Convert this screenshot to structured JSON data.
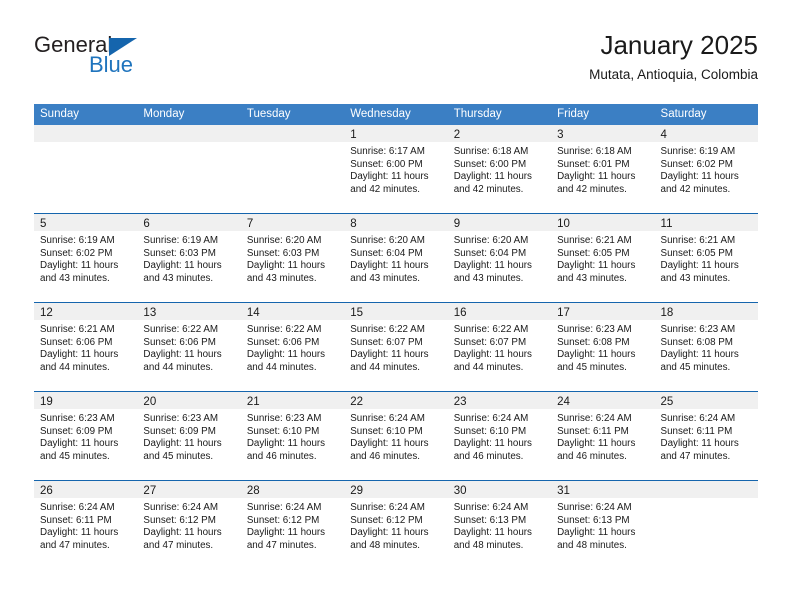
{
  "brand": {
    "name_part1": "General",
    "name_part2": "Blue",
    "accent_color": "#1565ad"
  },
  "header": {
    "title": "January 2025",
    "location": "Mutata, Antioquia, Colombia"
  },
  "theme": {
    "header_row_bg": "#3b7fc4",
    "row_separator": "#1565ad",
    "daynum_band_bg": "#f0f0f0",
    "text": "#1a1a1a"
  },
  "weekday_headers": [
    "Sunday",
    "Monday",
    "Tuesday",
    "Wednesday",
    "Thursday",
    "Friday",
    "Saturday"
  ],
  "weeks": [
    [
      {
        "day": "",
        "sunrise": "",
        "sunset": "",
        "daylight_line1": "",
        "daylight_line2": ""
      },
      {
        "day": "",
        "sunrise": "",
        "sunset": "",
        "daylight_line1": "",
        "daylight_line2": ""
      },
      {
        "day": "",
        "sunrise": "",
        "sunset": "",
        "daylight_line1": "",
        "daylight_line2": ""
      },
      {
        "day": "1",
        "sunrise": "Sunrise: 6:17 AM",
        "sunset": "Sunset: 6:00 PM",
        "daylight_line1": "Daylight: 11 hours",
        "daylight_line2": "and 42 minutes."
      },
      {
        "day": "2",
        "sunrise": "Sunrise: 6:18 AM",
        "sunset": "Sunset: 6:00 PM",
        "daylight_line1": "Daylight: 11 hours",
        "daylight_line2": "and 42 minutes."
      },
      {
        "day": "3",
        "sunrise": "Sunrise: 6:18 AM",
        "sunset": "Sunset: 6:01 PM",
        "daylight_line1": "Daylight: 11 hours",
        "daylight_line2": "and 42 minutes."
      },
      {
        "day": "4",
        "sunrise": "Sunrise: 6:19 AM",
        "sunset": "Sunset: 6:02 PM",
        "daylight_line1": "Daylight: 11 hours",
        "daylight_line2": "and 42 minutes."
      }
    ],
    [
      {
        "day": "5",
        "sunrise": "Sunrise: 6:19 AM",
        "sunset": "Sunset: 6:02 PM",
        "daylight_line1": "Daylight: 11 hours",
        "daylight_line2": "and 43 minutes."
      },
      {
        "day": "6",
        "sunrise": "Sunrise: 6:19 AM",
        "sunset": "Sunset: 6:03 PM",
        "daylight_line1": "Daylight: 11 hours",
        "daylight_line2": "and 43 minutes."
      },
      {
        "day": "7",
        "sunrise": "Sunrise: 6:20 AM",
        "sunset": "Sunset: 6:03 PM",
        "daylight_line1": "Daylight: 11 hours",
        "daylight_line2": "and 43 minutes."
      },
      {
        "day": "8",
        "sunrise": "Sunrise: 6:20 AM",
        "sunset": "Sunset: 6:04 PM",
        "daylight_line1": "Daylight: 11 hours",
        "daylight_line2": "and 43 minutes."
      },
      {
        "day": "9",
        "sunrise": "Sunrise: 6:20 AM",
        "sunset": "Sunset: 6:04 PM",
        "daylight_line1": "Daylight: 11 hours",
        "daylight_line2": "and 43 minutes."
      },
      {
        "day": "10",
        "sunrise": "Sunrise: 6:21 AM",
        "sunset": "Sunset: 6:05 PM",
        "daylight_line1": "Daylight: 11 hours",
        "daylight_line2": "and 43 minutes."
      },
      {
        "day": "11",
        "sunrise": "Sunrise: 6:21 AM",
        "sunset": "Sunset: 6:05 PM",
        "daylight_line1": "Daylight: 11 hours",
        "daylight_line2": "and 43 minutes."
      }
    ],
    [
      {
        "day": "12",
        "sunrise": "Sunrise: 6:21 AM",
        "sunset": "Sunset: 6:06 PM",
        "daylight_line1": "Daylight: 11 hours",
        "daylight_line2": "and 44 minutes."
      },
      {
        "day": "13",
        "sunrise": "Sunrise: 6:22 AM",
        "sunset": "Sunset: 6:06 PM",
        "daylight_line1": "Daylight: 11 hours",
        "daylight_line2": "and 44 minutes."
      },
      {
        "day": "14",
        "sunrise": "Sunrise: 6:22 AM",
        "sunset": "Sunset: 6:06 PM",
        "daylight_line1": "Daylight: 11 hours",
        "daylight_line2": "and 44 minutes."
      },
      {
        "day": "15",
        "sunrise": "Sunrise: 6:22 AM",
        "sunset": "Sunset: 6:07 PM",
        "daylight_line1": "Daylight: 11 hours",
        "daylight_line2": "and 44 minutes."
      },
      {
        "day": "16",
        "sunrise": "Sunrise: 6:22 AM",
        "sunset": "Sunset: 6:07 PM",
        "daylight_line1": "Daylight: 11 hours",
        "daylight_line2": "and 44 minutes."
      },
      {
        "day": "17",
        "sunrise": "Sunrise: 6:23 AM",
        "sunset": "Sunset: 6:08 PM",
        "daylight_line1": "Daylight: 11 hours",
        "daylight_line2": "and 45 minutes."
      },
      {
        "day": "18",
        "sunrise": "Sunrise: 6:23 AM",
        "sunset": "Sunset: 6:08 PM",
        "daylight_line1": "Daylight: 11 hours",
        "daylight_line2": "and 45 minutes."
      }
    ],
    [
      {
        "day": "19",
        "sunrise": "Sunrise: 6:23 AM",
        "sunset": "Sunset: 6:09 PM",
        "daylight_line1": "Daylight: 11 hours",
        "daylight_line2": "and 45 minutes."
      },
      {
        "day": "20",
        "sunrise": "Sunrise: 6:23 AM",
        "sunset": "Sunset: 6:09 PM",
        "daylight_line1": "Daylight: 11 hours",
        "daylight_line2": "and 45 minutes."
      },
      {
        "day": "21",
        "sunrise": "Sunrise: 6:23 AM",
        "sunset": "Sunset: 6:10 PM",
        "daylight_line1": "Daylight: 11 hours",
        "daylight_line2": "and 46 minutes."
      },
      {
        "day": "22",
        "sunrise": "Sunrise: 6:24 AM",
        "sunset": "Sunset: 6:10 PM",
        "daylight_line1": "Daylight: 11 hours",
        "daylight_line2": "and 46 minutes."
      },
      {
        "day": "23",
        "sunrise": "Sunrise: 6:24 AM",
        "sunset": "Sunset: 6:10 PM",
        "daylight_line1": "Daylight: 11 hours",
        "daylight_line2": "and 46 minutes."
      },
      {
        "day": "24",
        "sunrise": "Sunrise: 6:24 AM",
        "sunset": "Sunset: 6:11 PM",
        "daylight_line1": "Daylight: 11 hours",
        "daylight_line2": "and 46 minutes."
      },
      {
        "day": "25",
        "sunrise": "Sunrise: 6:24 AM",
        "sunset": "Sunset: 6:11 PM",
        "daylight_line1": "Daylight: 11 hours",
        "daylight_line2": "and 47 minutes."
      }
    ],
    [
      {
        "day": "26",
        "sunrise": "Sunrise: 6:24 AM",
        "sunset": "Sunset: 6:11 PM",
        "daylight_line1": "Daylight: 11 hours",
        "daylight_line2": "and 47 minutes."
      },
      {
        "day": "27",
        "sunrise": "Sunrise: 6:24 AM",
        "sunset": "Sunset: 6:12 PM",
        "daylight_line1": "Daylight: 11 hours",
        "daylight_line2": "and 47 minutes."
      },
      {
        "day": "28",
        "sunrise": "Sunrise: 6:24 AM",
        "sunset": "Sunset: 6:12 PM",
        "daylight_line1": "Daylight: 11 hours",
        "daylight_line2": "and 47 minutes."
      },
      {
        "day": "29",
        "sunrise": "Sunrise: 6:24 AM",
        "sunset": "Sunset: 6:12 PM",
        "daylight_line1": "Daylight: 11 hours",
        "daylight_line2": "and 48 minutes."
      },
      {
        "day": "30",
        "sunrise": "Sunrise: 6:24 AM",
        "sunset": "Sunset: 6:13 PM",
        "daylight_line1": "Daylight: 11 hours",
        "daylight_line2": "and 48 minutes."
      },
      {
        "day": "31",
        "sunrise": "Sunrise: 6:24 AM",
        "sunset": "Sunset: 6:13 PM",
        "daylight_line1": "Daylight: 11 hours",
        "daylight_line2": "and 48 minutes."
      },
      {
        "day": "",
        "sunrise": "",
        "sunset": "",
        "daylight_line1": "",
        "daylight_line2": ""
      }
    ]
  ]
}
